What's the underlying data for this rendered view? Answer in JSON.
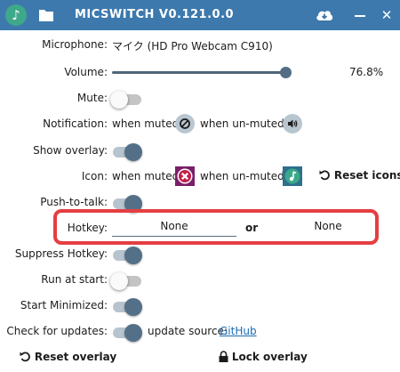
{
  "window": {
    "title": "MICSWITCH V0.121.0.0"
  },
  "icons": {
    "app": "music-note-icon",
    "folder": "folder-icon",
    "cloud": "cloud-download-icon",
    "mute_state": "muted-circle-icon",
    "unmute_state": "speaker-icon",
    "overlay_muted": "red-x-icon",
    "overlay_unmuted": "green-note-icon",
    "reset": "reset-icon",
    "lock": "lock-icon"
  },
  "colors": {
    "titlebar": "#3d79ad",
    "accent": "#537088",
    "highlight_border": "#e43f42",
    "link": "#1a6cb3"
  },
  "microphone": {
    "label": "Microphone:",
    "value": "マイク (HD Pro Webcam C910)"
  },
  "volume": {
    "label": "Volume:",
    "value_text": "76.8%",
    "value": 0.768
  },
  "mute": {
    "label": "Mute:",
    "on": false
  },
  "notification": {
    "label": "Notification:",
    "when_muted": "when muted",
    "when_unmuted": "when un-muted"
  },
  "show_overlay": {
    "label": "Show overlay:",
    "on": true
  },
  "icon": {
    "label": "Icon:",
    "when_muted": "when muted",
    "when_unmuted": "when un-muted",
    "reset_label": "Reset icons"
  },
  "push_to_talk": {
    "label": "Push-to-talk:",
    "on": true
  },
  "hotkey": {
    "label": "Hotkey:",
    "first_value": "None",
    "or": "or",
    "second_value": "None"
  },
  "suppress_hotkey": {
    "label": "Suppress Hotkey:",
    "on": true
  },
  "run_at_start": {
    "label": "Run at start:",
    "on": false
  },
  "start_minimized": {
    "label": "Start Minimized:",
    "on": true
  },
  "check_updates": {
    "label": "Check for updates:",
    "on": true,
    "source_label": "update source:",
    "source_link": "GitHub"
  },
  "footer": {
    "reset_overlay": "Reset overlay",
    "lock_overlay": "Lock overlay"
  }
}
